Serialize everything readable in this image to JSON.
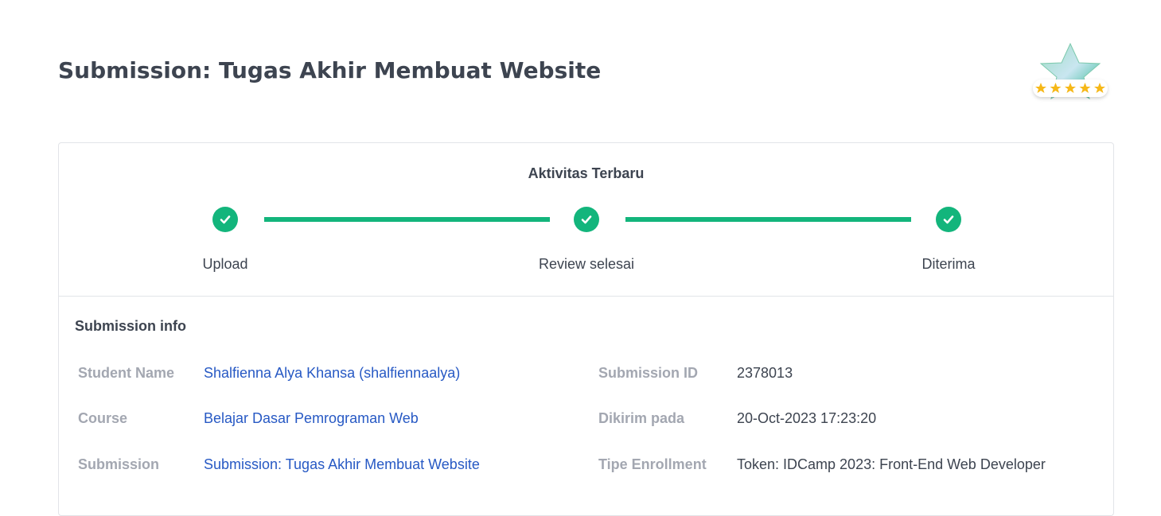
{
  "page": {
    "title": "Submission: Tugas Akhir Membuat Website"
  },
  "badge": {
    "icon": "star-rating-badge-icon",
    "stars": 5
  },
  "activity": {
    "title": "Aktivitas Terbaru",
    "steps": [
      {
        "label": "Upload",
        "status": "done"
      },
      {
        "label": "Review selesai",
        "status": "done"
      },
      {
        "label": "Diterima",
        "status": "done"
      }
    ]
  },
  "submission_info": {
    "title": "Submission info",
    "left": [
      {
        "label": "Student Name",
        "value": "Shalfienna Alya Khansa (shalfiennaalya)"
      },
      {
        "label": "Course",
        "value": "Belajar Dasar Pemrograman Web"
      },
      {
        "label": "Submission",
        "value": "Submission: Tugas Akhir Membuat Website"
      }
    ],
    "right": [
      {
        "label": "Submission ID",
        "value": "2378013"
      },
      {
        "label": "Dikirim pada",
        "value": "20-Oct-2023 17:23:20"
      },
      {
        "label": "Tipe Enrollment",
        "value": "Token: IDCamp 2023: Front-End Web Developer"
      }
    ]
  },
  "colors": {
    "accent_green": "#13b57c",
    "link_blue": "#2759c4",
    "label_gray": "#a3a7b1",
    "text_dark": "#3d4450",
    "star_gold": "#f6b818"
  }
}
